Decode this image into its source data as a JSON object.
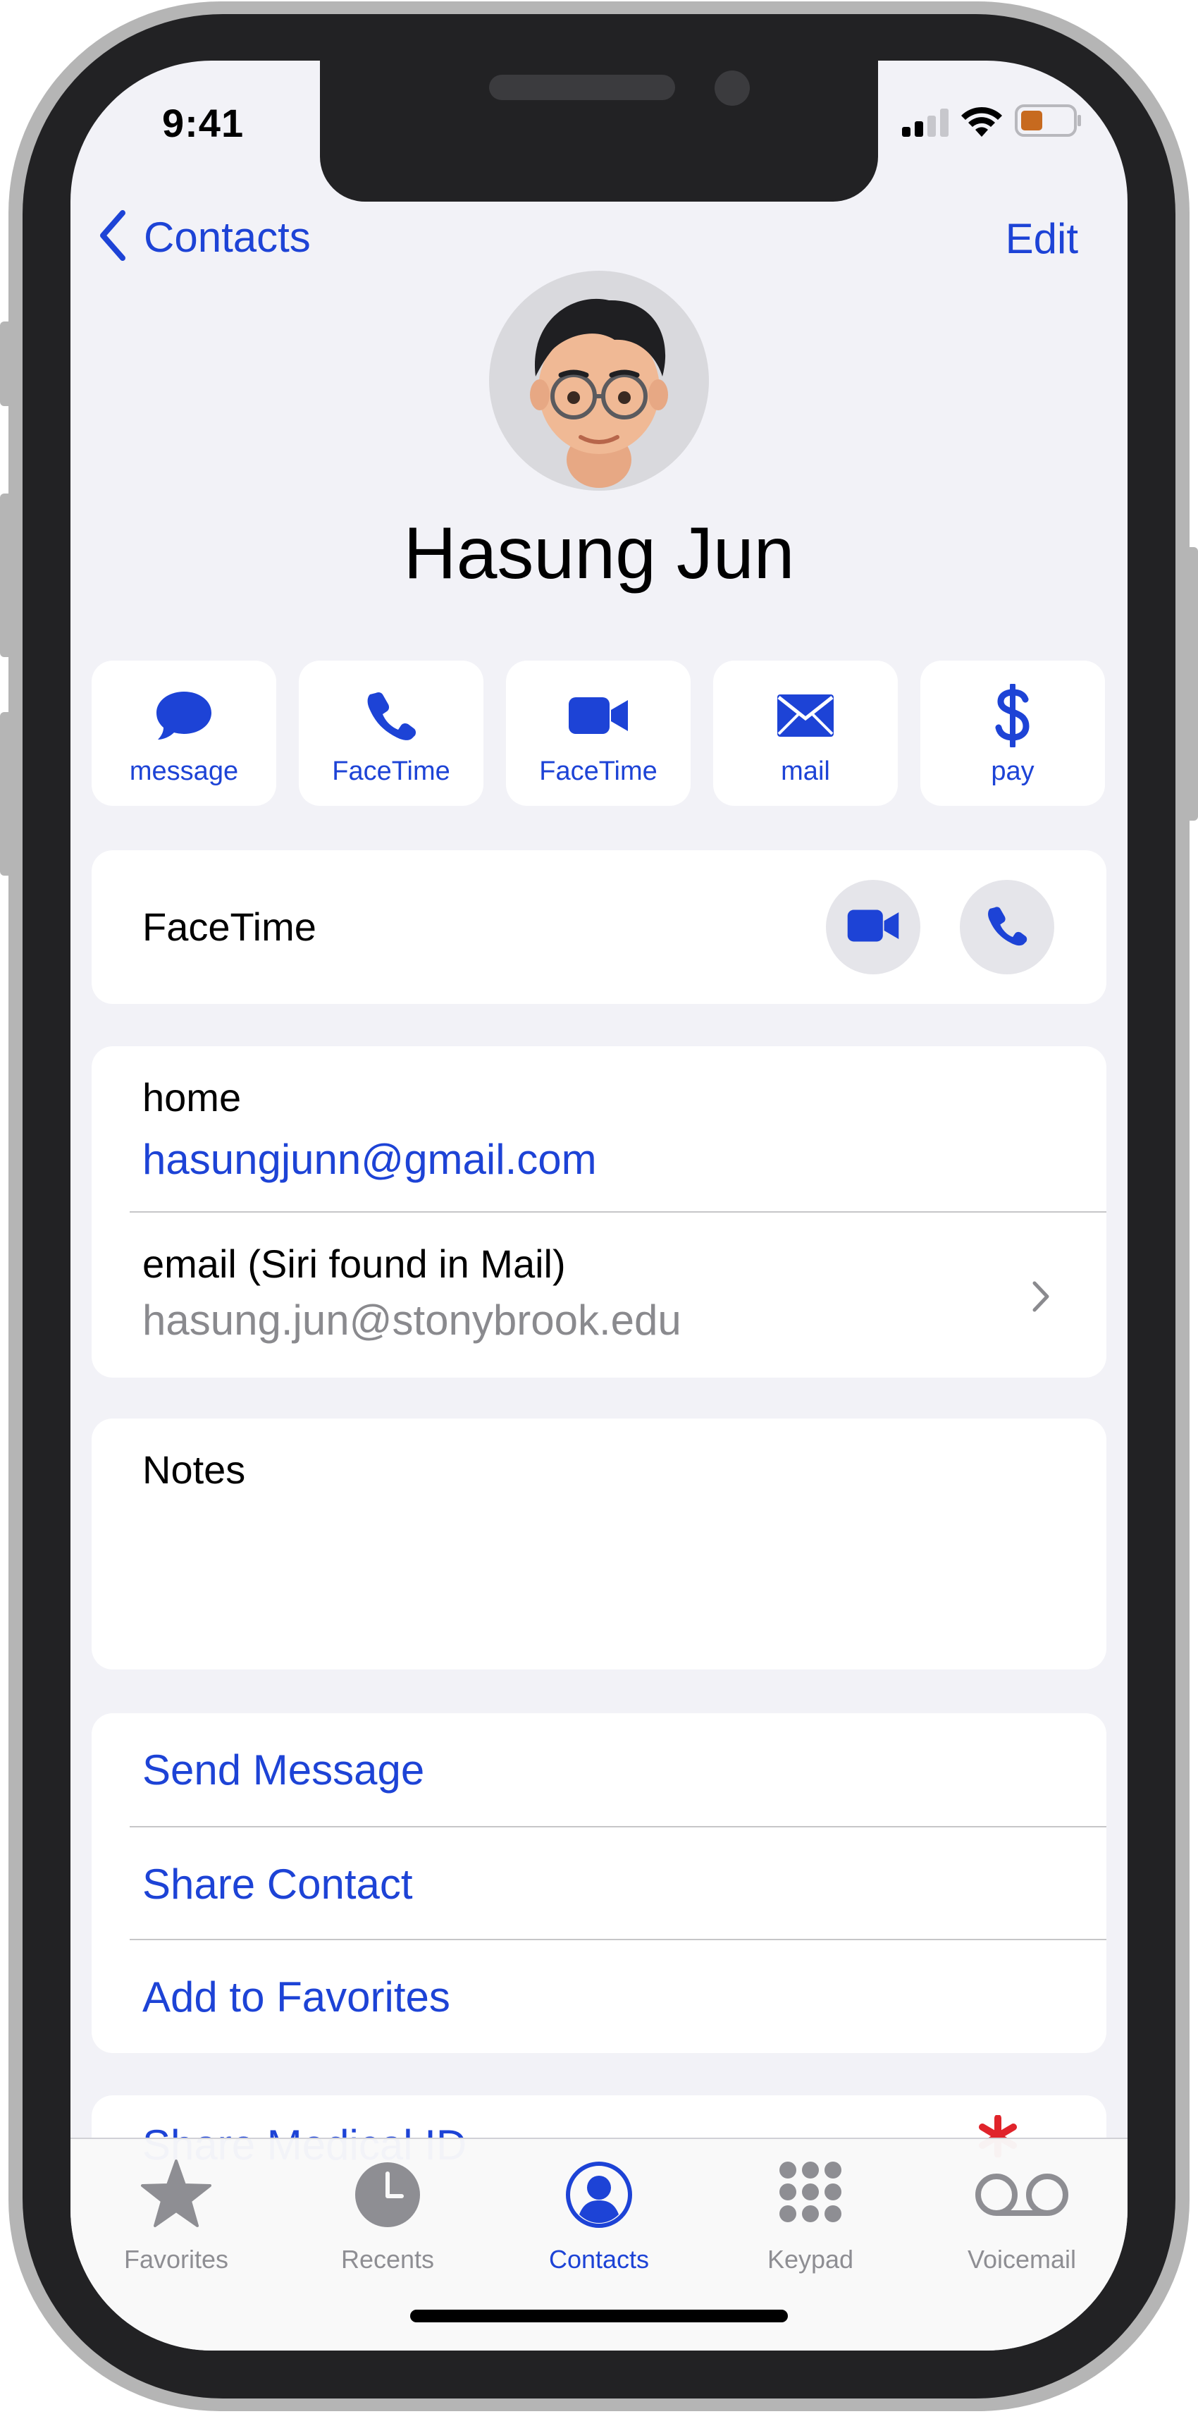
{
  "status_bar": {
    "time": "9:41"
  },
  "nav": {
    "back_label": "Contacts",
    "edit_label": "Edit"
  },
  "contact": {
    "name": "Hasung Jun"
  },
  "quick_actions": [
    {
      "label": "message",
      "icon": "message-bubble-icon"
    },
    {
      "label": "FaceTime",
      "icon": "phone-icon"
    },
    {
      "label": "FaceTime",
      "icon": "video-camera-icon"
    },
    {
      "label": "mail",
      "icon": "envelope-icon"
    },
    {
      "label": "pay",
      "icon": "dollar-sign-icon"
    }
  ],
  "facetime_row": {
    "label": "FaceTime"
  },
  "emails": [
    {
      "label": "home",
      "value": "hasungjunn@gmail.com"
    },
    {
      "label": "email (Siri found in Mail)",
      "value": "hasung.jun@stonybrook.edu"
    }
  ],
  "notes": {
    "label": "Notes"
  },
  "actions": [
    "Send Message",
    "Share Contact",
    "Add to Favorites"
  ],
  "partial_row": {
    "label": "Share Medical ID"
  },
  "tabs": [
    {
      "label": "Favorites",
      "icon": "star-icon",
      "active": false
    },
    {
      "label": "Recents",
      "icon": "clock-icon",
      "active": false
    },
    {
      "label": "Contacts",
      "icon": "person-circle-icon",
      "active": true
    },
    {
      "label": "Keypad",
      "icon": "keypad-icon",
      "active": false
    },
    {
      "label": "Voicemail",
      "icon": "voicemail-icon",
      "active": false
    }
  ],
  "colors": {
    "accent": "#1d43d6",
    "background": "#f2f2f7",
    "card": "#ffffff",
    "secondary_text": "#8a8a8e",
    "battery": "#c76a1f"
  }
}
